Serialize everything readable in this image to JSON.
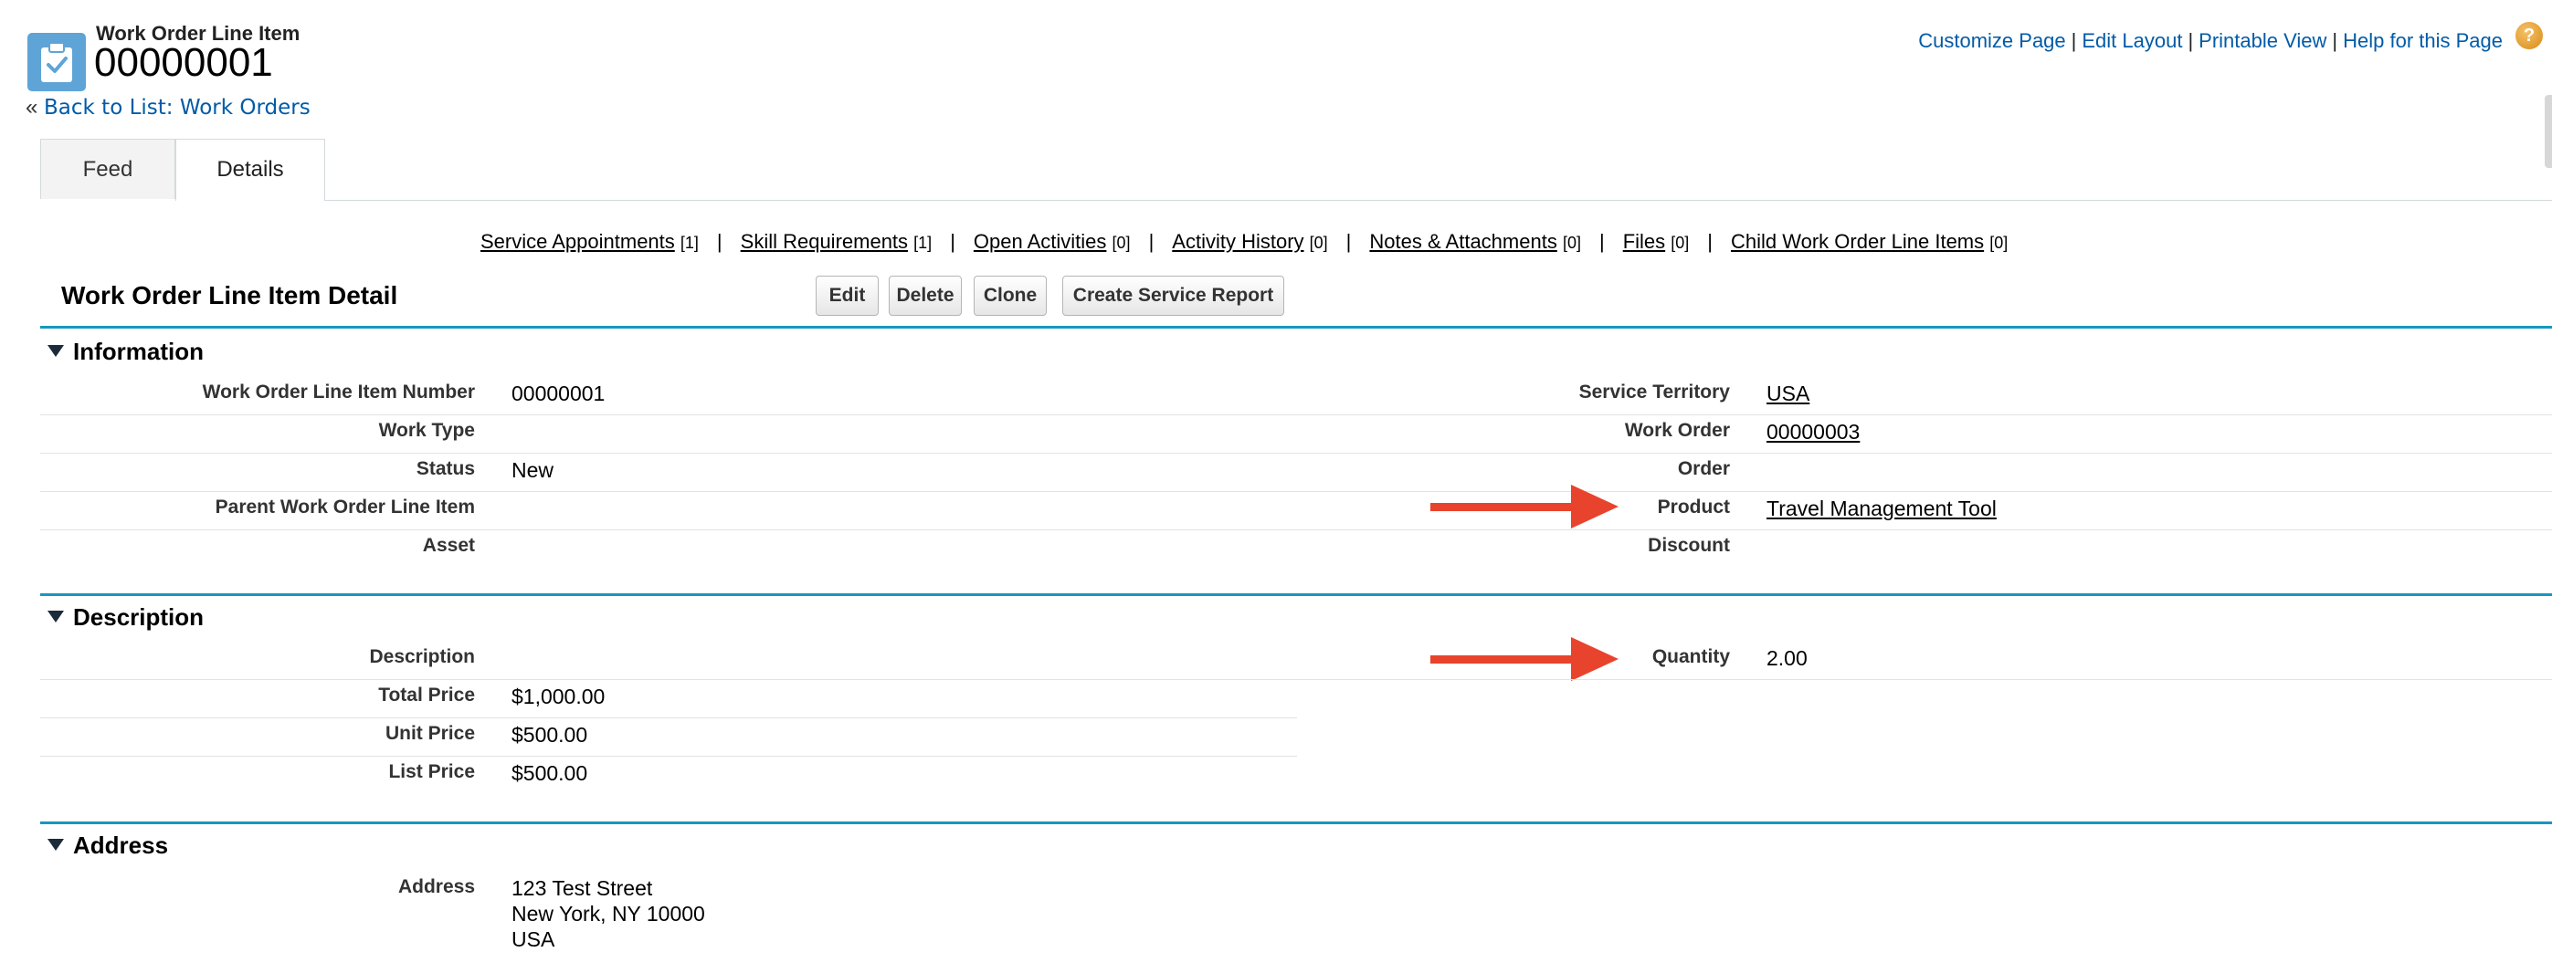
{
  "header": {
    "record_type": "Work Order Line Item",
    "record_number": "00000001",
    "back_prefix": "«",
    "back_link": "Back to List: Work Orders",
    "top_links": [
      "Customize Page",
      "Edit Layout",
      "Printable View",
      "Help for this Page"
    ],
    "separator": "|",
    "help_icon": "?"
  },
  "tabs": [
    {
      "label": "Feed",
      "active": false
    },
    {
      "label": "Details",
      "active": true
    }
  ],
  "related_lists": [
    {
      "label": "Service Appointments",
      "count": "[1]"
    },
    {
      "label": "Skill Requirements",
      "count": "[1]"
    },
    {
      "label": "Open Activities",
      "count": "[0]"
    },
    {
      "label": "Activity History",
      "count": "[0]"
    },
    {
      "label": "Notes & Attachments",
      "count": "[0]"
    },
    {
      "label": "Files",
      "count": "[0]"
    },
    {
      "label": "Child Work Order Line Items",
      "count": "[0]"
    }
  ],
  "detail": {
    "title": "Work Order Line Item Detail",
    "buttons": [
      "Edit",
      "Delete",
      "Clone",
      "Create Service Report"
    ]
  },
  "sections": {
    "information": {
      "title": "Information",
      "left": [
        {
          "label": "Work Order Line Item Number",
          "value": "00000001"
        },
        {
          "label": "Work Type",
          "value": ""
        },
        {
          "label": "Status",
          "value": "New"
        },
        {
          "label": "Parent Work Order Line Item",
          "value": ""
        },
        {
          "label": "Asset",
          "value": ""
        }
      ],
      "right": [
        {
          "label": "Service Territory",
          "value": "USA",
          "link": true
        },
        {
          "label": "Work Order",
          "value": "00000003",
          "link": true
        },
        {
          "label": "Order",
          "value": ""
        },
        {
          "label": "Product",
          "value": "Travel Management Tool",
          "link": true
        },
        {
          "label": "Discount",
          "value": ""
        }
      ]
    },
    "description": {
      "title": "Description",
      "left": [
        {
          "label": "Description",
          "value": ""
        },
        {
          "label": "Total Price",
          "value": "$1,000.00"
        },
        {
          "label": "Unit Price",
          "value": "$500.00"
        },
        {
          "label": "List Price",
          "value": "$500.00"
        }
      ],
      "right": [
        {
          "label": "Quantity",
          "value": "2.00"
        }
      ]
    },
    "address": {
      "title": "Address",
      "label": "Address",
      "lines": [
        "123 Test Street",
        "New York, NY 10000",
        "USA"
      ]
    }
  },
  "annotations": {
    "arrow_color": "#e8432d",
    "arrow_targets": [
      "Product",
      "Quantity"
    ]
  },
  "colors": {
    "link": "#015ba7",
    "section_rule": "#1797c0",
    "record_icon": "#5ea4d6"
  }
}
